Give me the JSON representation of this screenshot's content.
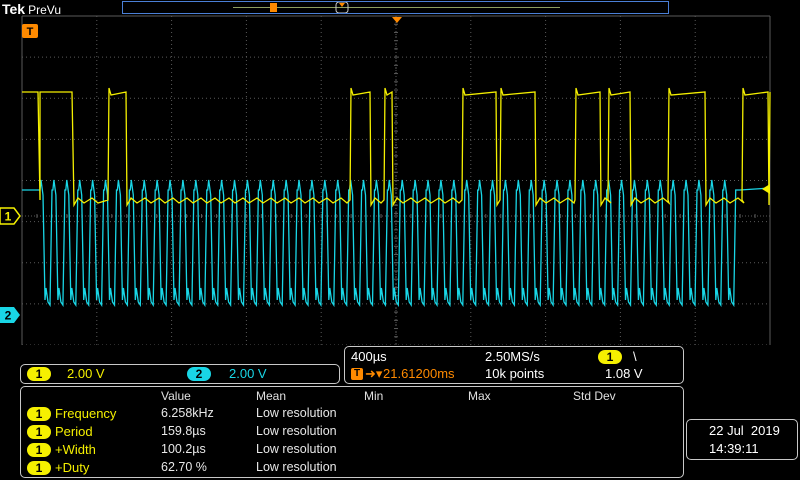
{
  "brand": {
    "name": "Tek",
    "mode": "PreVu"
  },
  "channels": [
    {
      "id": "1",
      "scale": "2.00 V",
      "color": "#f5f000"
    },
    {
      "id": "2",
      "scale": "2.00 V",
      "color": "#19d6e6"
    }
  ],
  "acquisition": {
    "timebase": "400µs",
    "sample_rate": "2.50MS/s",
    "trigger_source": "1",
    "trigger_slope": "\\",
    "trigger_position": "21.61200ms",
    "record_length": "10k points",
    "trigger_level": "1.08 V"
  },
  "measurements": {
    "headers": [
      "Value",
      "Mean",
      "Min",
      "Max",
      "Std Dev"
    ],
    "rows": [
      {
        "source": "1",
        "name": "Frequency",
        "value": "6.258kHz",
        "mean": "Low resolution"
      },
      {
        "source": "1",
        "name": "Period",
        "value": "159.8µs",
        "mean": "Low resolution"
      },
      {
        "source": "1",
        "name": "+Width",
        "value": "100.2µs",
        "mean": "Low resolution"
      },
      {
        "source": "1",
        "name": "+Duty",
        "value": "62.70 %",
        "mean": "Low resolution"
      }
    ]
  },
  "datetime": {
    "date": "22 Jul  2019",
    "time": "14:39:11"
  },
  "markers": {
    "trigger": "T",
    "ch1": "1",
    "ch2": "2"
  },
  "colors": {
    "ch1": "#f5f000",
    "ch2": "#19d6e6",
    "trigger": "#ff8a00",
    "grid": "#5a5a5a",
    "record_bar": "#4a7fd6"
  }
}
